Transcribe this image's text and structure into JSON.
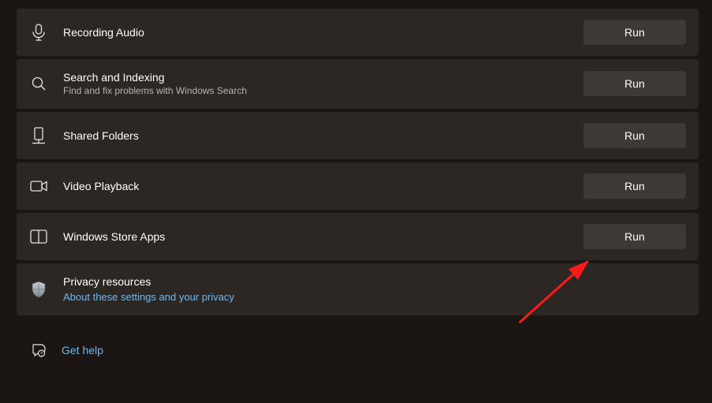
{
  "troubleshooters": [
    {
      "id": "recording-audio",
      "icon": "microphone-icon",
      "title": "Recording Audio",
      "subtitle": null,
      "button": "Run"
    },
    {
      "id": "search-indexing",
      "icon": "search-icon",
      "title": "Search and Indexing",
      "subtitle": "Find and fix problems with Windows Search",
      "button": "Run"
    },
    {
      "id": "shared-folders",
      "icon": "shared-folder-icon",
      "title": "Shared Folders",
      "subtitle": null,
      "button": "Run"
    },
    {
      "id": "video-playback",
      "icon": "video-icon",
      "title": "Video Playback",
      "subtitle": null,
      "button": "Run"
    },
    {
      "id": "windows-store-apps",
      "icon": "store-icon",
      "title": "Windows Store Apps",
      "subtitle": null,
      "button": "Run"
    }
  ],
  "privacy": {
    "icon": "shield-icon",
    "title": "Privacy resources",
    "link": "About these settings and your privacy"
  },
  "help": {
    "icon": "help-icon",
    "label": "Get help"
  }
}
